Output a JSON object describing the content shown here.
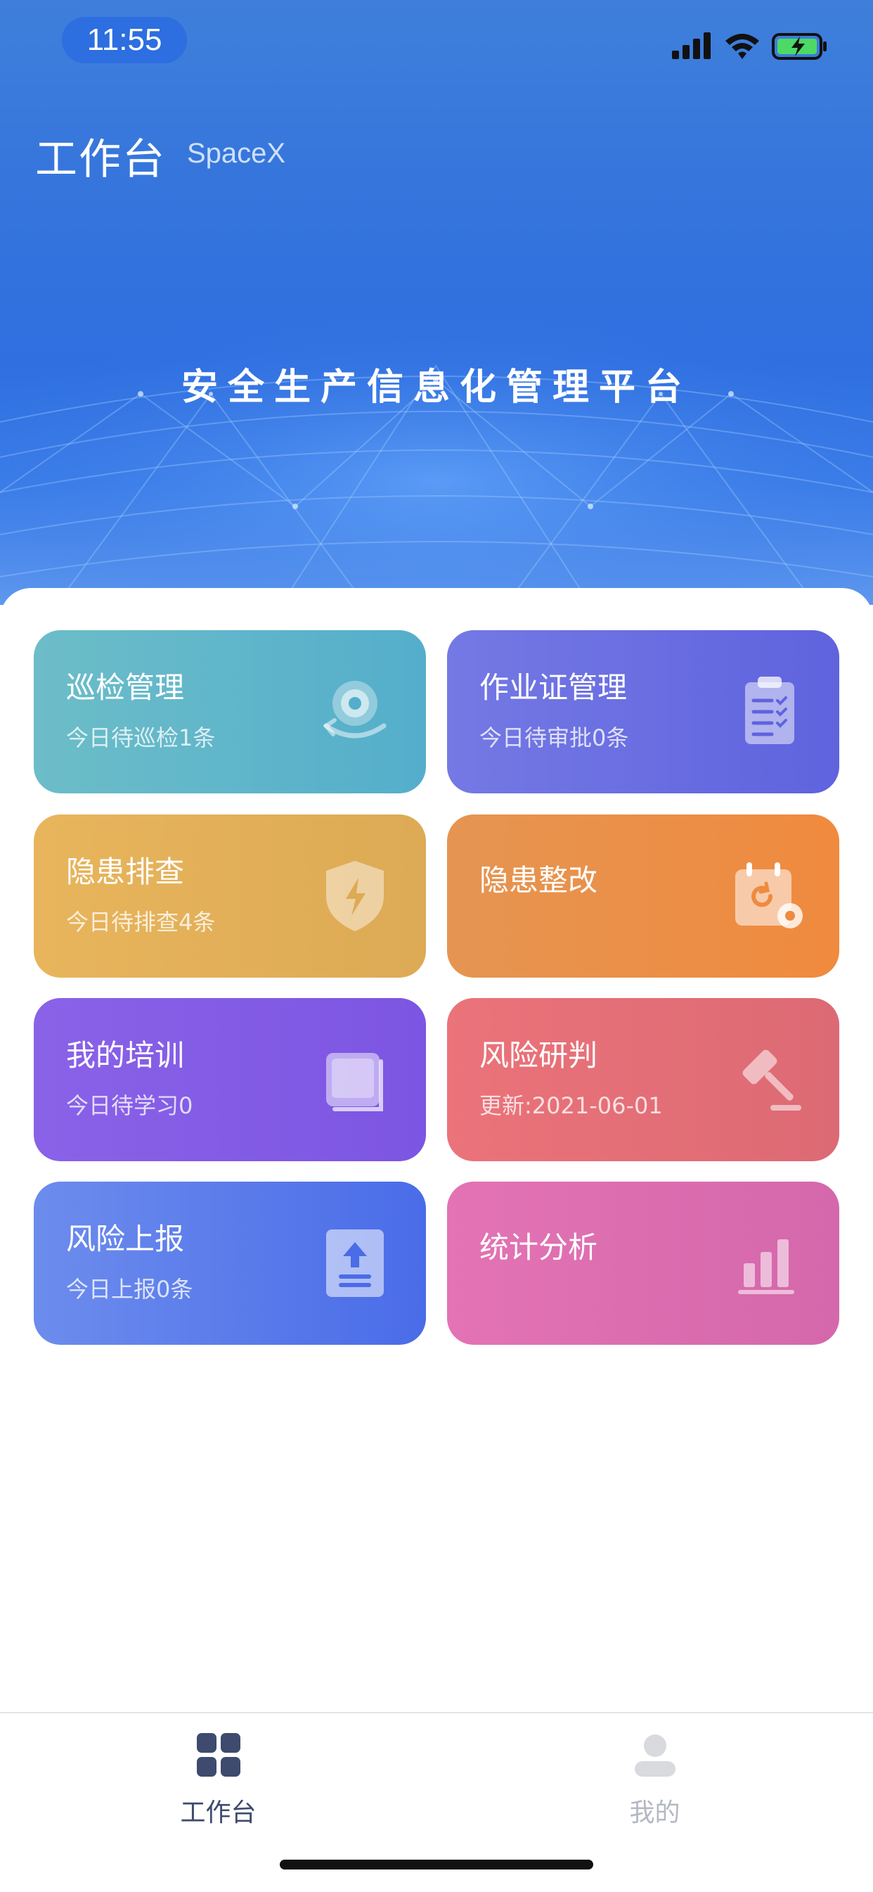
{
  "status_bar": {
    "time": "11:55"
  },
  "header": {
    "title": "工作台",
    "org": "SpaceX",
    "platform_title": "安全生产信息化管理平台"
  },
  "cards": [
    {
      "title": "巡检管理",
      "subtitle": "今日待巡检1条",
      "icon": "inspection-camera-icon"
    },
    {
      "title": "作业证管理",
      "subtitle": "今日待审批0条",
      "icon": "clipboard-checklist-icon"
    },
    {
      "title": "隐患排查",
      "subtitle": "今日待排查4条",
      "icon": "shield-lightning-icon"
    },
    {
      "title": "隐患整改",
      "subtitle": "",
      "icon": "calendar-refresh-gear-icon"
    },
    {
      "title": "我的培训",
      "subtitle": "今日待学习0",
      "icon": "book-icon"
    },
    {
      "title": "风险研判",
      "subtitle": "更新:2021-06-01",
      "icon": "gavel-icon"
    },
    {
      "title": "风险上报",
      "subtitle": "今日上报0条",
      "icon": "upload-document-icon"
    },
    {
      "title": "统计分析",
      "subtitle": "",
      "icon": "bar-chart-icon"
    }
  ],
  "tabbar": {
    "items": [
      {
        "label": "工作台",
        "icon": "grid-icon",
        "active": true
      },
      {
        "label": "我的",
        "icon": "user-icon",
        "active": false
      }
    ]
  },
  "colors": {
    "banner_blue": "#3474dc",
    "tab_active": "#3e4a6e",
    "tab_inactive": "#b4b8c2"
  }
}
